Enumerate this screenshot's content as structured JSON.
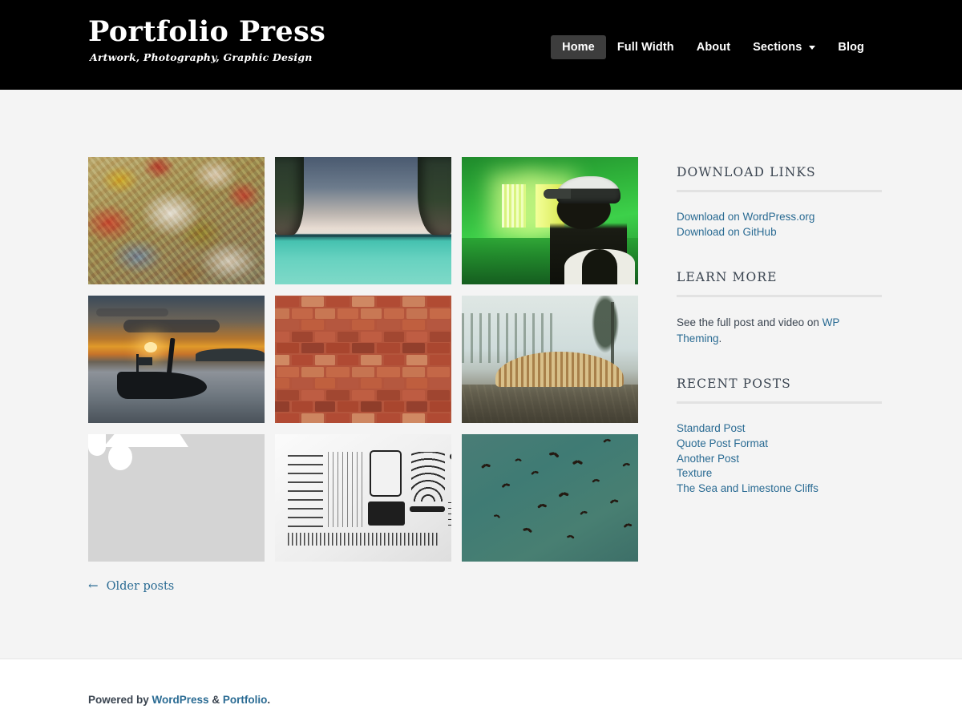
{
  "header": {
    "site_title": "Portfolio Press",
    "site_description": "Artwork, Photography, Graphic Design",
    "nav": [
      {
        "label": "Home",
        "current": true,
        "has_dropdown": false
      },
      {
        "label": "Full Width",
        "current": false,
        "has_dropdown": false
      },
      {
        "label": "About",
        "current": false,
        "has_dropdown": false
      },
      {
        "label": "Sections",
        "current": false,
        "has_dropdown": true
      },
      {
        "label": "Blog",
        "current": false,
        "has_dropdown": false
      }
    ]
  },
  "grid": {
    "items": [
      {
        "name": "peeling-paint-texture",
        "alt": "Weathered wall with peeling red, white and yellow paint"
      },
      {
        "name": "limestone-cliffs-sea",
        "alt": "Limestone cliffs framing a turquoise sea under storm clouds"
      },
      {
        "name": "green-neon-room",
        "alt": "Silhouette of a person in a cap inside a green neon lit room"
      },
      {
        "name": "sunset-longtail-boat",
        "alt": "Longtail boat silhouetted against an orange sunset over water"
      },
      {
        "name": "red-brick-wall",
        "alt": "Close up of a red brick wall"
      },
      {
        "name": "foggy-forest-logpile",
        "alt": "Stack of cut logs in a misty forest clearing"
      },
      {
        "name": "image-placeholder",
        "alt": "Placeholder image icon"
      },
      {
        "name": "typewriter-parts-flatlay",
        "alt": "Disassembled typewriter parts arranged on a white surface"
      },
      {
        "name": "birds-teal-sky",
        "alt": "Flock of birds flying against a teal sky"
      }
    ]
  },
  "pagination": {
    "older_arrow": "←",
    "older_label": "Older posts"
  },
  "sidebar": {
    "widgets": [
      {
        "title": "Download Links",
        "type": "links",
        "links": [
          {
            "label": "Download on WordPress.org"
          },
          {
            "label": "Download on GitHub"
          }
        ]
      },
      {
        "title": "Learn More",
        "type": "text",
        "text_before": "See the full post and video on ",
        "link_label": "WP Theming",
        "text_after": "."
      },
      {
        "title": "Recent Posts",
        "type": "links",
        "links": [
          {
            "label": "Standard Post"
          },
          {
            "label": "Quote Post Format"
          },
          {
            "label": "Another Post"
          },
          {
            "label": "Texture"
          },
          {
            "label": "The Sea and Limestone Cliffs"
          }
        ]
      }
    ]
  },
  "footer": {
    "prefix": "Powered by ",
    "link1": "WordPress",
    "middle": " & ",
    "link2": "Portfolio",
    "suffix": "."
  },
  "colors": {
    "header_bg": "#000000",
    "page_bg": "#f4f4f4",
    "footer_bg": "#ffffff",
    "link": "#2a6b93",
    "text": "#3a4450",
    "nav_active_bg": "#3d3d3d",
    "rule": "#e2e2e2"
  }
}
